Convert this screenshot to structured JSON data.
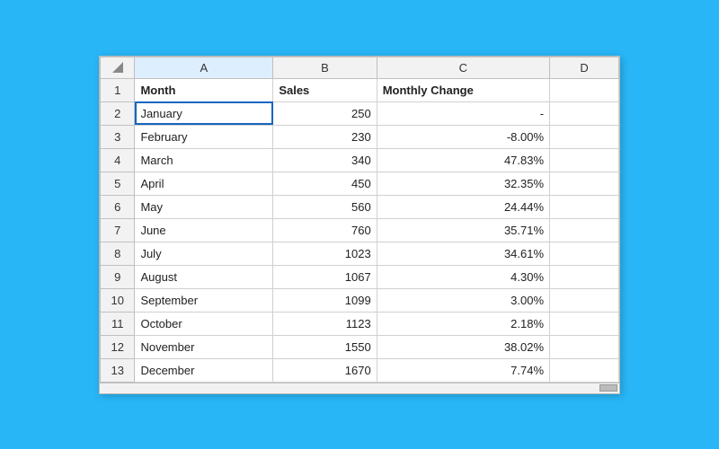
{
  "spreadsheet": {
    "columns": [
      "",
      "A",
      "B",
      "C",
      "D"
    ],
    "rows": [
      {
        "row_num": "1",
        "col_a": "Month",
        "col_b": "Sales",
        "col_c": "Monthly Change",
        "col_d": "",
        "is_header": true
      },
      {
        "row_num": "2",
        "col_a": "January",
        "col_b": "250",
        "col_c": "-",
        "col_d": "",
        "is_header": false
      },
      {
        "row_num": "3",
        "col_a": "February",
        "col_b": "230",
        "col_c": "-8.00%",
        "col_d": "",
        "is_header": false
      },
      {
        "row_num": "4",
        "col_a": "March",
        "col_b": "340",
        "col_c": "47.83%",
        "col_d": "",
        "is_header": false
      },
      {
        "row_num": "5",
        "col_a": "April",
        "col_b": "450",
        "col_c": "32.35%",
        "col_d": "",
        "is_header": false
      },
      {
        "row_num": "6",
        "col_a": "May",
        "col_b": "560",
        "col_c": "24.44%",
        "col_d": "",
        "is_header": false
      },
      {
        "row_num": "7",
        "col_a": "June",
        "col_b": "760",
        "col_c": "35.71%",
        "col_d": "",
        "is_header": false
      },
      {
        "row_num": "8",
        "col_a": "July",
        "col_b": "1023",
        "col_c": "34.61%",
        "col_d": "",
        "is_header": false
      },
      {
        "row_num": "9",
        "col_a": "August",
        "col_b": "1067",
        "col_c": "4.30%",
        "col_d": "",
        "is_header": false
      },
      {
        "row_num": "10",
        "col_a": "September",
        "col_b": "1099",
        "col_c": "3.00%",
        "col_d": "",
        "is_header": false
      },
      {
        "row_num": "11",
        "col_a": "October",
        "col_b": "1123",
        "col_c": "2.18%",
        "col_d": "",
        "is_header": false
      },
      {
        "row_num": "12",
        "col_a": "November",
        "col_b": "1550",
        "col_c": "38.02%",
        "col_d": "",
        "is_header": false
      },
      {
        "row_num": "13",
        "col_a": "December",
        "col_b": "1670",
        "col_c": "7.74%",
        "col_d": "",
        "is_header": false
      }
    ]
  }
}
